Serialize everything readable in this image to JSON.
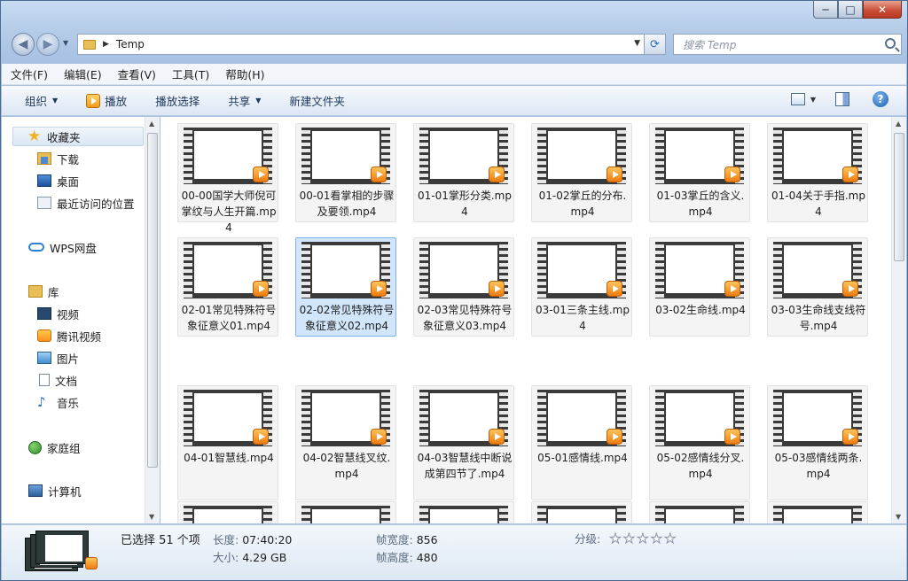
{
  "window": {
    "caption_min": "─",
    "caption_max": "□",
    "caption_close": "✕"
  },
  "address": {
    "folder": "Temp",
    "search_placeholder": "搜索 Temp"
  },
  "menu": [
    "文件(F)",
    "编辑(E)",
    "查看(V)",
    "工具(T)",
    "帮助(H)"
  ],
  "commands": {
    "organize": "组织",
    "play": "播放",
    "play_selection": "播放选择",
    "share": "共享",
    "new_folder": "新建文件夹"
  },
  "nav": {
    "favorites": "收藏夹",
    "downloads": "下载",
    "desktop": "桌面",
    "recent": "最近访问的位置",
    "wps": "WPS网盘",
    "library": "库",
    "videos": "视频",
    "tencent_video": "腾讯视频",
    "pictures": "图片",
    "documents": "文档",
    "music": "音乐",
    "homegroup": "家庭组",
    "computer": "计算机"
  },
  "files": [
    "00-00国学大师倪可掌纹与人生开篇.mp4",
    "00-01看掌相的步骤及要领.mp4",
    "01-01掌形分类.mp4",
    "01-02掌丘的分布.mp4",
    "01-03掌丘的含义.mp4",
    "01-04关于手指.mp4",
    "02-01常见特殊符号象征意义01.mp4",
    "02-02常见特殊符号象征意义02.mp4",
    "02-03常见特殊符号象征意义03.mp4",
    "03-01三条主线.mp4",
    "03-02生命线.mp4",
    "03-03生命线支线符号.mp4",
    "04-01智慧线.mp4",
    "04-02智慧线叉纹.mp4",
    "04-03智慧线中断说成第四节了.mp4",
    "05-01感情线.mp4",
    "05-02感情线分叉.mp4",
    "05-03感情线两条.mp4"
  ],
  "selected_index": 7,
  "details": {
    "selected": "已选择 51 个项",
    "duration_label": "长度:",
    "duration": "07:40:20",
    "size_label": "大小:",
    "size": "4.29 GB",
    "width_label": "帧宽度:",
    "width": "856",
    "height_label": "帧高度:",
    "height": "480",
    "rating_label": "分级:",
    "rating_stars": 0
  }
}
